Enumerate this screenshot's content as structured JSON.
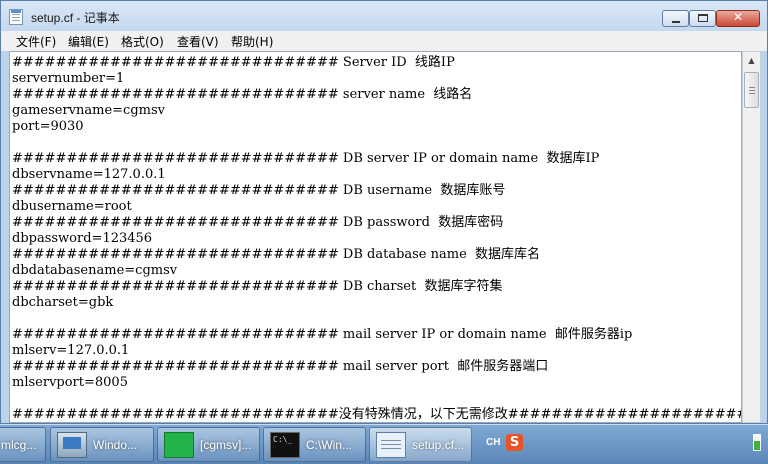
{
  "window": {
    "title": "setup.cf - 记事本",
    "close_glyph": "✕"
  },
  "menu": [
    "文件(F)",
    "编辑(E)",
    "格式(O)",
    "查看(V)",
    "帮助(H)"
  ],
  "editor": {
    "lines": [
      "############################## Server ID  线路IP",
      "servernumber=1",
      "############################## server name  线路名",
      "gameservname=cgmsv",
      "port=9030",
      "",
      "############################## DB server IP or domain name  数据库IP",
      "dbservname=127.0.0.1",
      "############################## DB username  数据库账号",
      "dbusername=root",
      "############################## DB password  数据库密码",
      "dbpassword=123456",
      "############################## DB database name  数据库库名",
      "dbdatabasename=cgmsv",
      "############################## DB charset  数据库字符集",
      "dbcharset=gbk",
      "",
      "############################## mail server IP or domain name  邮件服务器ip",
      "mlserv=127.0.0.1",
      "############################## mail server port  邮件服务器端口",
      "mlservport=8005",
      "",
      "##############################没有特殊情况，以下无需修改#########################"
    ]
  },
  "taskbar": {
    "items": [
      {
        "label": "mlcg...",
        "icon": "console-icon",
        "active": false
      },
      {
        "label": "Windo...",
        "icon": "windows-icon",
        "active": false
      },
      {
        "label": "[cgmsv]...",
        "icon": "cgmsv-icon",
        "active": false
      },
      {
        "label": "C:\\Win...",
        "icon": "cmd-icon",
        "active": false
      },
      {
        "label": "setup.cf...",
        "icon": "notepad-icon",
        "active": true
      }
    ],
    "tray": {
      "language": "CH",
      "ime_glyph": "S",
      "icons": [
        "sogou-ime-icon",
        "battery-icon"
      ]
    }
  },
  "colors": {
    "taskbar": "#5a86b7",
    "close_button": "#c84a33",
    "editor_bg": "#ffffff",
    "text": "#000000"
  }
}
